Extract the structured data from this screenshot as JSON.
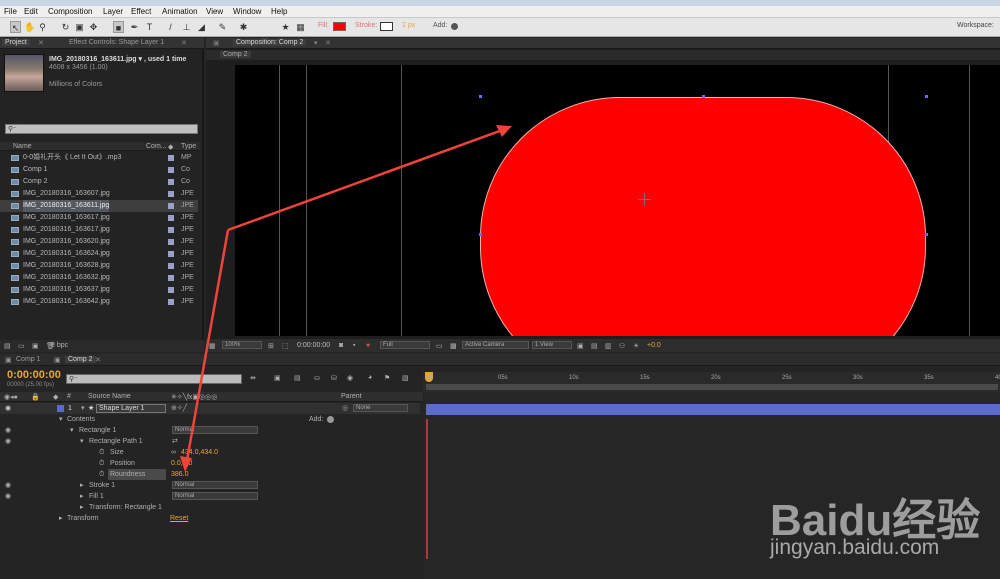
{
  "menu": [
    "File",
    "Edit",
    "Composition",
    "Layer",
    "Effect",
    "Animation",
    "View",
    "Window",
    "Help"
  ],
  "toolbar": {
    "fill_label": "Fill:",
    "fill_color": "#ff0000",
    "stroke_label": "Stroke:",
    "stroke_width": "2 px",
    "add_label": "Add:",
    "workspace_label": "Workspace:"
  },
  "project": {
    "tab_project": "Project",
    "tab_effect": "Effect Controls: Shape Layer 1",
    "file_name": "IMG_20180316_163611.jpg ▾ , used 1 time",
    "file_dims": "4608 x 3456 (1.00)",
    "file_colors": "Millions of Colors",
    "col_name": "Name",
    "col_comment": "Com...",
    "col_type": "Type",
    "items": [
      {
        "name": "0-0婚礼开头《 Let It Out》.mp3",
        "type": "MP"
      },
      {
        "name": "Comp 1",
        "type": "Co"
      },
      {
        "name": "Comp 2",
        "type": "Co"
      },
      {
        "name": "IMG_20180316_163607.jpg",
        "type": "JPE"
      },
      {
        "name": "IMG_20180316_163611.jpg",
        "type": "JPE"
      },
      {
        "name": "IMG_20180316_163617.jpg",
        "type": "JPE"
      },
      {
        "name": "IMG_20180316_163617.jpg",
        "type": "JPE"
      },
      {
        "name": "IMG_20180316_163620.jpg",
        "type": "JPE"
      },
      {
        "name": "IMG_20180316_163624.jpg",
        "type": "JPE"
      },
      {
        "name": "IMG_20180316_163628.jpg",
        "type": "JPE"
      },
      {
        "name": "IMG_20180316_163632.jpg",
        "type": "JPE"
      },
      {
        "name": "IMG_20180316_163637.jpg",
        "type": "JPE"
      },
      {
        "name": "IMG_20180316_163642.jpg",
        "type": "JPE"
      }
    ],
    "bpc": "8 bpc"
  },
  "comp": {
    "tab": "Composition: Comp 2",
    "sub": "Comp 2",
    "zoom": "100%",
    "timecode": "0:00:00:00",
    "resolution": "Full",
    "camera": "Active Camera",
    "views": "1 View",
    "offset": "+0.0"
  },
  "timeline": {
    "tabs": [
      "Comp 1",
      "Comp 2"
    ],
    "timecode": "0:00:00:00",
    "fps": "00000 (25.00 fps)",
    "col_source": "Source Name",
    "col_parent": "Parent",
    "ruler": [
      "0s",
      "05s",
      "10s",
      "15s",
      "20s",
      "25s",
      "30s",
      "35s",
      "40s"
    ],
    "layer_num": "1",
    "layer_name": "Shape Layer 1",
    "parent": "None",
    "contents": "Contents",
    "add": "Add:",
    "rect": "Rectangle 1",
    "rect_mode": "Normal",
    "path": "Rectangle Path 1",
    "size_label": "Size",
    "size_val": "434.0,434.0",
    "pos_label": "Position",
    "pos_val": "0.0,0.0",
    "round_label": "Roundness",
    "round_val": "386.0",
    "stroke": "Stroke 1",
    "stroke_mode": "Normal",
    "fill": "Fill 1",
    "fill_mode": "Normal",
    "transform_rect": "Transform: Rectangle 1",
    "transform": "Transform",
    "reset": "Reset"
  },
  "watermark": {
    "brand": "Baidu经验",
    "url": "jingyan.baidu.com"
  }
}
